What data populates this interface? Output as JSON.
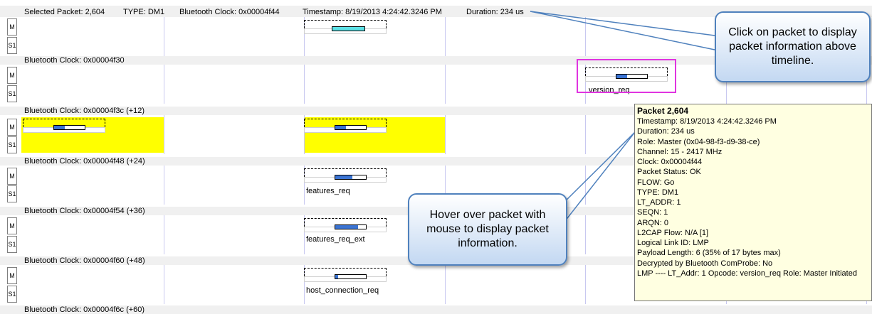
{
  "selection_bar": {
    "packet": "Selected Packet: 2,604",
    "type": "TYPE: DM1",
    "clock": "Bluetooth Clock: 0x00004f44",
    "timestamp": "Timestamp: 8/19/2013 4:24:42.3246 PM",
    "duration": "Duration: 234 us"
  },
  "roles": {
    "master": "M",
    "slave": "S1"
  },
  "rows": [
    {
      "clock_label": ""
    },
    {
      "clock_label": "Bluetooth Clock: 0x00004f30"
    },
    {
      "clock_label": "Bluetooth Clock: 0x00004f3c (+12)"
    },
    {
      "clock_label": "Bluetooth Clock: 0x00004f48 (+24)"
    },
    {
      "clock_label": "Bluetooth Clock: 0x00004f54 (+36)"
    },
    {
      "clock_label": "Bluetooth Clock: 0x00004f60 (+48)"
    },
    {
      "clock_label": "Bluetooth Clock: 0x00004f6c (+60)"
    }
  ],
  "packet_labels": {
    "version_req": "version_req",
    "features_req": "features_req",
    "features_req_ext": "features_req_ext",
    "host_connection_req": "host_connection_req"
  },
  "tooltip": {
    "title": "Packet 2,604",
    "lines": [
      "Timestamp: 8/19/2013 4:24:42.3246 PM",
      "Duration: 234 us",
      "Role: Master (0x04-98-f3-d9-38-ce)",
      "Channel: 15 - 2417 MHz",
      "Clock: 0x00004f44",
      "Packet Status: OK",
      "FLOW: Go",
      "TYPE: DM1",
      "LT_ADDR: 1",
      "SEQN: 1",
      "ARQN: 0",
      "L2CAP Flow: N/A [1]",
      "Logical Link ID: LMP",
      "Payload Length: 6 (35% of 17 bytes max)",
      "Decrypted by Bluetooth ComProbe: No",
      "LMP ---- LT_Addr: 1 Opcode: version_req Role: Master Initiated"
    ]
  },
  "callouts": {
    "click": [
      "Click on packet  to display",
      "packet information above",
      "timeline."
    ],
    "hover": [
      "Hover over packet with",
      "mouse to display packet",
      "information."
    ]
  },
  "colors": {
    "highlight_slot": "#ffff00",
    "selected_packet_bar": "#5ce1e6",
    "packet_bar": "#3b74d3",
    "selection_box": "#e034e0",
    "tooltip_bg": "#ffffe1",
    "callout_border": "#4f81bd"
  }
}
